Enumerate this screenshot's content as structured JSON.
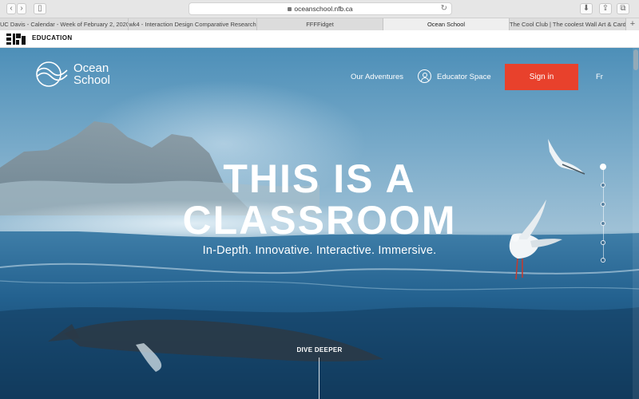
{
  "browser": {
    "url": "oceanschool.nfb.ca",
    "back_icon": "chevron-left-icon",
    "forward_icon": "chevron-right-icon",
    "tabs": [
      {
        "label": "UC Davis - Calendar - Week of February 2, 2020"
      },
      {
        "label": "wk4 - Interaction Design Comparative Research"
      },
      {
        "label": "FFFFidget"
      },
      {
        "label": "Ocean School",
        "active": true
      },
      {
        "label": "The Cool Club | The coolest Wall Art & Card G..."
      }
    ],
    "new_tab_label": "+"
  },
  "nfb_bar": {
    "label": "EDUCATION"
  },
  "header": {
    "brand_line1": "Ocean",
    "brand_line2": "School",
    "nav": {
      "adventures": "Our Adventures",
      "educator": "Educator Space",
      "signin": "Sign in",
      "language": "Fr"
    }
  },
  "hero": {
    "headline_line1": "THIS IS A",
    "headline_line2": "CLASSROOM",
    "tagline": "In-Depth. Innovative. Interactive. Immersive.",
    "dive_label": "DIVE DEEPER"
  },
  "section_nav": {
    "count": 6,
    "active_index": 0
  },
  "colors": {
    "accent_signin": "#e8412c",
    "ocean_deep": "#15476e",
    "sky": "#78aac9"
  }
}
